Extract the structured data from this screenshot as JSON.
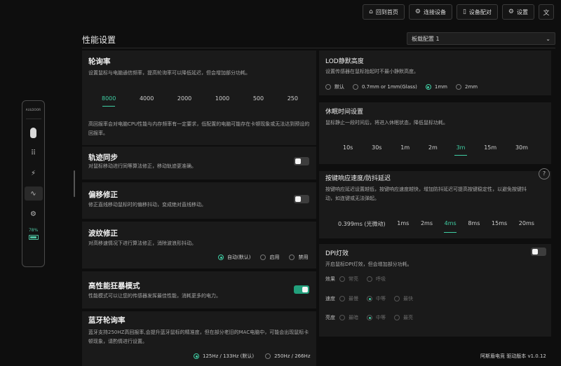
{
  "topbar": {
    "home": "回到首页",
    "connect": "连接设备",
    "pair": "设备配对",
    "settings": "设置"
  },
  "page": {
    "title": "性能设置",
    "profile": "板载配置 1"
  },
  "device": {
    "logo": "AULDOOR",
    "battery": "78%",
    "battery_level": 0.78
  },
  "polling": {
    "title": "轮询率",
    "desc": "设置鼠标与电脑通信频率，提高轮询率可以降低延迟，但会增加部分功耗。",
    "options": [
      "8000",
      "4000",
      "2000",
      "1000",
      "500",
      "250"
    ],
    "selected": "8000",
    "note": "高回报率会对电脑CPU性能与内存频率有一定要求，低配置的电脑可能存在卡顿现象或无法达到预设的回报率。"
  },
  "trace_sync": {
    "title": "轨迹同步",
    "desc": "对鼠标移动进行同等算法修正，移动轨迹更准确。",
    "on": false
  },
  "offset_fix": {
    "title": "偏移修正",
    "desc": "修正直线移动鼠标时的偏移抖动，变成绝对直线移动。",
    "on": false
  },
  "ripple_fix": {
    "title": "波纹修正",
    "desc": "对高移速情况下进行算法修正，消除波浪形抖动。",
    "options": [
      "自动(默认)",
      "启用",
      "禁用"
    ],
    "selected": "自动(默认)"
  },
  "hiperf": {
    "title": "高性能狂暴模式",
    "desc": "性能模式可以让您的传感器发挥最佳性能，消耗更多的电力。",
    "on": true
  },
  "bt_rate": {
    "title": "蓝牙轮询率",
    "desc": "蓝牙支持250HZ高回报率,会提升蓝牙鼠标的精准度，但在部分老旧的MAC电脑中，可能会出现鼠标卡顿现象，请酌情进行设置。",
    "options": [
      "125Hz / 133Hz (默认)",
      "250Hz / 266Hz"
    ],
    "selected": "125Hz / 133Hz (默认)"
  },
  "lod": {
    "title": "LOD静默高度",
    "desc": "设置传感器在鼠标抬起时不最小静默高度。",
    "options": [
      "默认",
      "0.7mm or 1mm(Glass)",
      "1mm",
      "2mm"
    ],
    "selected": "1mm"
  },
  "sleep": {
    "title": "休眠时间设置",
    "desc": "鼠标静止一段时间后，将进入休眠状态，降低鼠标功耗。",
    "options": [
      "10s",
      "30s",
      "1m",
      "2m",
      "3m",
      "15m",
      "30m"
    ],
    "selected": "3m"
  },
  "debounce": {
    "title": "按键响应速度/防抖延迟",
    "desc": "按键响应延迟设置越低，按键响应速度越快，增加防抖延迟可提高按键稳定性，以避免按键抖动，如连键或无法弹起。",
    "options": [
      "0.399ms (光微动)",
      "1ms",
      "2ms",
      "4ms",
      "8ms",
      "15ms",
      "20ms"
    ],
    "selected": "4ms"
  },
  "dpi_light": {
    "title": "DPI灯效",
    "desc": "开启鼠标DPI灯效，但会增加部分功耗。",
    "on": false,
    "effect_label": "效果",
    "effect_options": [
      "常亮",
      "呼吸"
    ],
    "speed_label": "速度",
    "speed_options": [
      "最慢",
      "中等",
      "最快"
    ],
    "speed_selected": "中等",
    "brightness_label": "亮度",
    "brightness_options": [
      "最暗",
      "中等",
      "最亮"
    ],
    "brightness_selected": "中等"
  },
  "footer": {
    "version": "阿斯盾电竞 驱动版本 v1.0.12"
  },
  "colors": {
    "accent": "#3fcfa4",
    "toggle_on": "#22a07c",
    "panel": "#1a1a1a",
    "bg": "#0e0e0e"
  }
}
